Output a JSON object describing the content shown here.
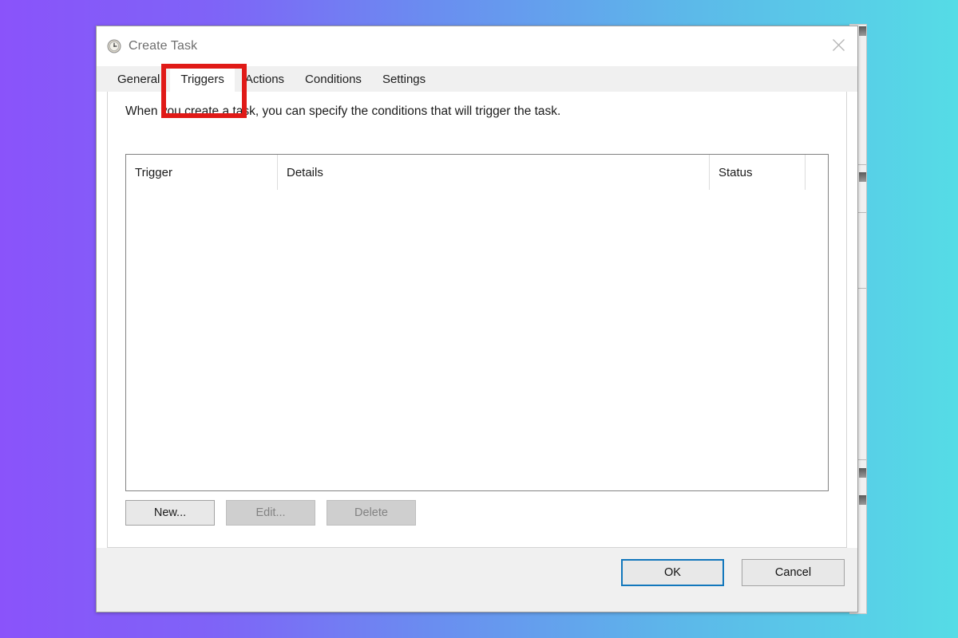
{
  "background": {
    "gradient_from": "#8a53fa",
    "gradient_to": "#55dce6"
  },
  "dialog": {
    "title": "Create Task",
    "title_icon": "clock-schedule-icon",
    "close_icon": "close-icon"
  },
  "tabs": [
    {
      "label": "General",
      "selected": false,
      "name": "tab-general"
    },
    {
      "label": "Triggers",
      "selected": true,
      "name": "tab-triggers"
    },
    {
      "label": "Actions",
      "selected": false,
      "name": "tab-actions"
    },
    {
      "label": "Conditions",
      "selected": false,
      "name": "tab-conditions"
    },
    {
      "label": "Settings",
      "selected": false,
      "name": "tab-settings"
    }
  ],
  "panel": {
    "description": "When you create a task, you can specify the conditions that will trigger the task."
  },
  "list": {
    "columns": [
      {
        "label": "Trigger"
      },
      {
        "label": "Details"
      },
      {
        "label": "Status"
      },
      {
        "label": ""
      }
    ],
    "rows": []
  },
  "action_buttons": [
    {
      "label": "New...",
      "enabled": true
    },
    {
      "label": "Edit...",
      "enabled": false
    },
    {
      "label": "Delete",
      "enabled": false
    }
  ],
  "footer_buttons": [
    {
      "label": "OK",
      "default": true
    },
    {
      "label": "Cancel",
      "default": false
    }
  ],
  "annotation": {
    "type": "red-rectangle-highlight",
    "target": "Triggers",
    "color": "#e01a17"
  }
}
